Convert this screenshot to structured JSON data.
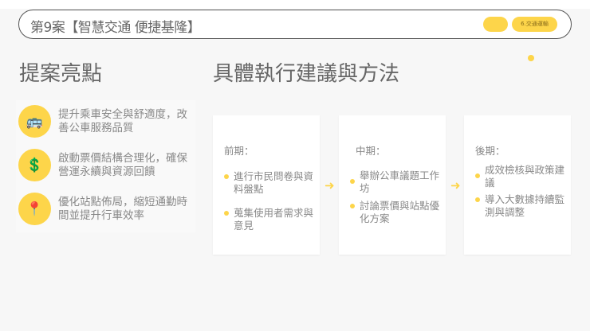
{
  "header": {
    "title": "第9案【智慧交通 便捷基隆】",
    "tag": "6.交通運輸"
  },
  "highlights": {
    "heading": "提案亮點",
    "items": [
      {
        "icon": "bus-icon",
        "glyph": "🚌",
        "text": "提升乘車安全與舒適度，改善公車服務品質"
      },
      {
        "icon": "dollar-icon",
        "glyph": "💲",
        "text": "啟動票價結構合理化，確保營運永續與資源回饋"
      },
      {
        "icon": "pin-icon",
        "glyph": "📍",
        "text": "優化站點佈局，縮短通勤時間並提升行車效率"
      }
    ]
  },
  "methods": {
    "heading": "具體執行建議與方法",
    "arrow": "➜",
    "phases": [
      {
        "label": "前期：",
        "bullets": [
          "進行市民問卷與資料盤點",
          "蒐集使用者需求與意見"
        ]
      },
      {
        "label": "中期：",
        "bullets": [
          "舉辦公車議題工作坊",
          "討論票價與站點優化方案"
        ]
      },
      {
        "label": "後期：",
        "bullets": [
          "成效檢核與政策建議",
          "導入大數據持續監測與調整"
        ]
      }
    ]
  },
  "colors": {
    "accent": "#fdd54a"
  }
}
